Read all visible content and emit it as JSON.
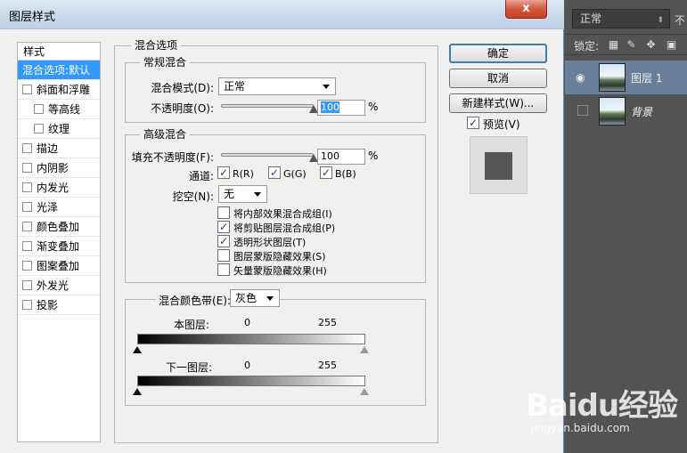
{
  "dialog": {
    "title": "图层样式",
    "close_label": "x"
  },
  "style_list": {
    "header": "样式",
    "items": [
      {
        "label": "混合选项:默认",
        "selected": true
      },
      {
        "label": "斜面和浮雕"
      },
      {
        "label": "等高线",
        "indent": true
      },
      {
        "label": "纹理",
        "indent": true
      },
      {
        "label": "描边"
      },
      {
        "label": "内阴影"
      },
      {
        "label": "内发光"
      },
      {
        "label": "光泽"
      },
      {
        "label": "颜色叠加"
      },
      {
        "label": "渐变叠加"
      },
      {
        "label": "图案叠加"
      },
      {
        "label": "外发光"
      },
      {
        "label": "投影"
      }
    ]
  },
  "blend_options": {
    "title": "混合选项",
    "general": {
      "title": "常规混合",
      "mode_label": "混合模式(D):",
      "mode_value": "正常",
      "opacity_label": "不透明度(O):",
      "opacity_value": "100",
      "opacity_level": 1.0,
      "pct": "%"
    },
    "advanced": {
      "title": "高级混合",
      "fill_label": "填充不透明度(F):",
      "fill_value": "100",
      "fill_level": 1.0,
      "pct": "%",
      "channels_label": "通道:",
      "channel_r": "R(R)",
      "channel_g": "G(G)",
      "channel_b": "B(B)",
      "knockout_label": "挖空(N):",
      "knockout_value": "无",
      "options": [
        {
          "label": "将内部效果混合成组(I)",
          "checked": false
        },
        {
          "label": "将剪贴图层混合成组(P)",
          "checked": true
        },
        {
          "label": "透明形状图层(T)",
          "checked": true
        },
        {
          "label": "图层蒙版隐藏效果(S)",
          "checked": false
        },
        {
          "label": "矢量蒙版隐藏效果(H)",
          "checked": false
        }
      ]
    },
    "blend_if": {
      "label": "混合颜色带(E):",
      "value": "灰色",
      "this_layer_label": "本图层:",
      "this_low": "0",
      "this_high": "255",
      "under_layer_label": "下一图层:",
      "under_low": "0",
      "under_high": "255"
    }
  },
  "buttons": {
    "ok": "确定",
    "cancel": "取消",
    "new_style": "新建样式(W)...",
    "preview": "预览(V)"
  },
  "layers_panel": {
    "blend_mode": "正常",
    "opacity_label": "不",
    "lock_label": "锁定:",
    "layers": [
      {
        "name": "图层 1",
        "active": true,
        "visible": true
      },
      {
        "name": "背景",
        "active": false,
        "visible": false,
        "italic": true
      }
    ]
  },
  "watermark": {
    "text": "Baidu经验",
    "sub": "jingyan.baidu.com"
  },
  "colors": {
    "selection": "#3399ff",
    "panel_bg": "#535353",
    "active_layer": "#6a7f99"
  }
}
